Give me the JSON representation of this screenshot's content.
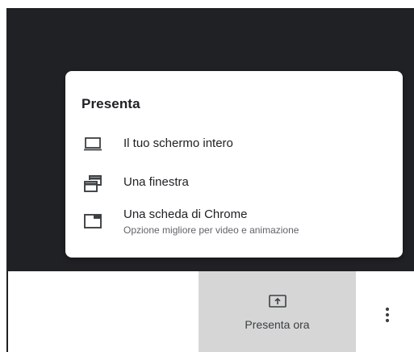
{
  "popup": {
    "title": "Presenta",
    "items": [
      {
        "label": "Il tuo schermo intero",
        "icon": "laptop-icon"
      },
      {
        "label": "Una finestra",
        "icon": "window-icon"
      },
      {
        "label": "Una scheda di Chrome",
        "sublabel": "Opzione migliore per video e animazione",
        "icon": "tab-icon"
      }
    ]
  },
  "toolbar": {
    "present_label": "Presenta ora",
    "present_icon": "present-screen-icon",
    "more_icon": "more-vert-icon"
  },
  "colors": {
    "dark_background": "#202124",
    "button_background": "#d6d6d6",
    "text_primary": "#202124",
    "text_secondary": "#5f6368"
  }
}
